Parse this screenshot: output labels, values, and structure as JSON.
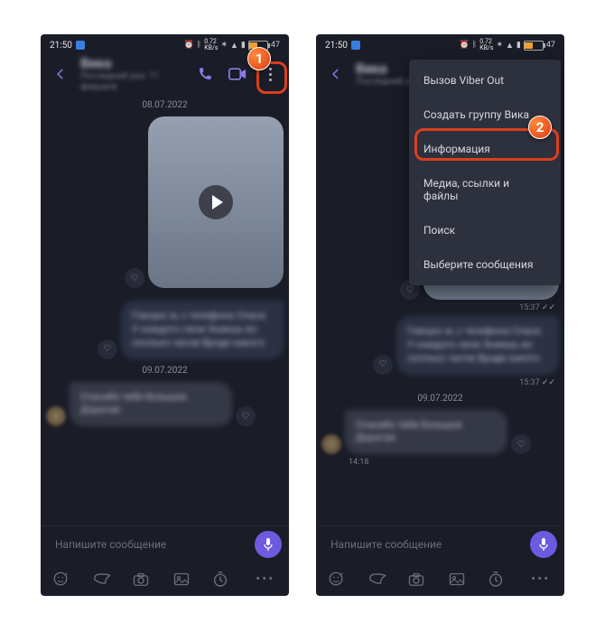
{
  "statusbar": {
    "time": "21:50",
    "speed_up": "0.72",
    "speed_unit": "KB/s",
    "battery_pct": "47",
    "battery_text": "47"
  },
  "header": {
    "contact_name": "Вика",
    "contact_sub": "Последний раз: 11 февраля"
  },
  "chat": {
    "date1": "08.07.2022",
    "date2": "09.07.2022",
    "msg_out1": "Говорю ж, с телефона\nСпаси. У каждого свои\nЗнаешь во сколько часов\nВроде какого",
    "msg_in1": "Спасибо тебе большое\nДорогая",
    "ts1": "15:37",
    "ts2": "15:37",
    "ts3": "14:18"
  },
  "inputbar": {
    "placeholder": "Напишите сообщение"
  },
  "menu": {
    "items": [
      "Вызов Viber Out",
      "Создать группу Вика",
      "Информация",
      "Медиа, ссылки и файлы",
      "Поиск",
      "Выберите сообщения"
    ]
  },
  "callouts": {
    "one": "1",
    "two": "2"
  }
}
